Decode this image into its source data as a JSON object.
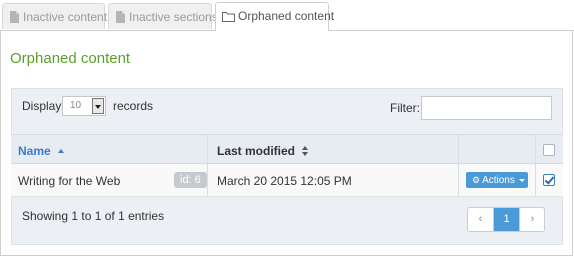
{
  "tabs": [
    {
      "label": "Inactive content",
      "icon": "document-icon",
      "active": false
    },
    {
      "label": "Inactive sections",
      "icon": "document-icon",
      "active": false
    },
    {
      "label": "Orphaned content",
      "icon": "folder-icon",
      "active": true
    }
  ],
  "page": {
    "title": "Orphaned content"
  },
  "controls": {
    "display_label": "Display",
    "records_per_page": "10",
    "records_label": "records",
    "filter_label": "Filter:",
    "filter_value": ""
  },
  "table": {
    "columns": [
      {
        "label": "Name",
        "sort": "ascending"
      },
      {
        "label": "Last modified",
        "sort": "sortable"
      }
    ],
    "rows": [
      {
        "name": "Writing for the Web",
        "id_badge": "id: 6",
        "last_modified": "March 20 2015 12:05 PM",
        "actions_label": "Actions",
        "selected": true
      }
    ],
    "select_all": false
  },
  "footer": {
    "info": "Showing 1 to 1 of 1 entries",
    "pagination": {
      "prev": "‹",
      "current": "1",
      "next": "›"
    }
  },
  "colors": {
    "title": "#5aa02c",
    "accent": "#4a9ad8",
    "link": "#3a7ec6"
  }
}
